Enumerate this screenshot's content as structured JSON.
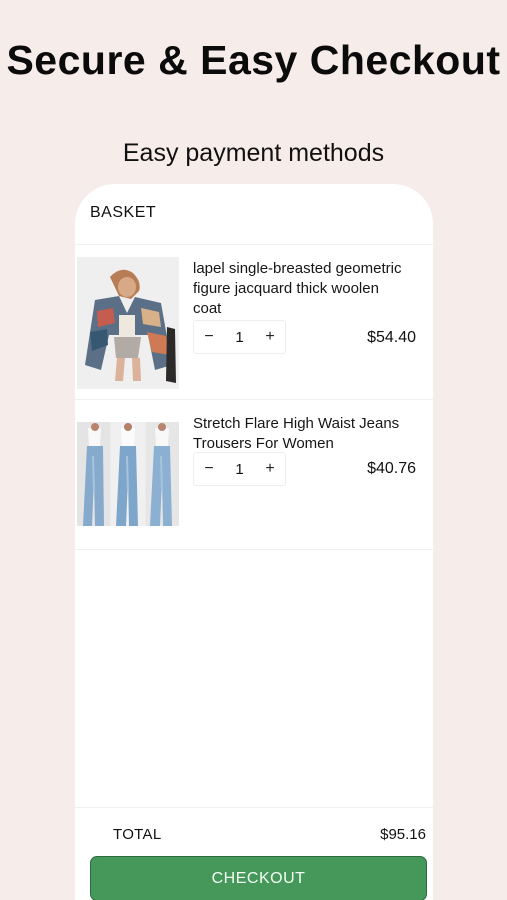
{
  "hero": {
    "title": "Secure & Easy Checkout",
    "subtitle": "Easy payment methods"
  },
  "basket": {
    "title": "BASKET",
    "items": [
      {
        "name": "lapel single-breasted geometric figure jacquard thick woolen coat",
        "quantity": "1",
        "price": "$54.40",
        "image": "jacket-product-photo"
      },
      {
        "name": "Stretch Flare High Waist Jeans Trousers For Women",
        "quantity": "1",
        "price": "$40.76",
        "image": "jeans-product-photo"
      }
    ],
    "decrement_symbol": "−",
    "increment_symbol": "+"
  },
  "footer": {
    "total_label": "TOTAL",
    "total_value": "$95.16",
    "checkout_label": "CHECKOUT"
  },
  "colors": {
    "background": "#f6ecea",
    "checkout_button": "#45975a",
    "checkout_border": "#2e6b3e"
  }
}
